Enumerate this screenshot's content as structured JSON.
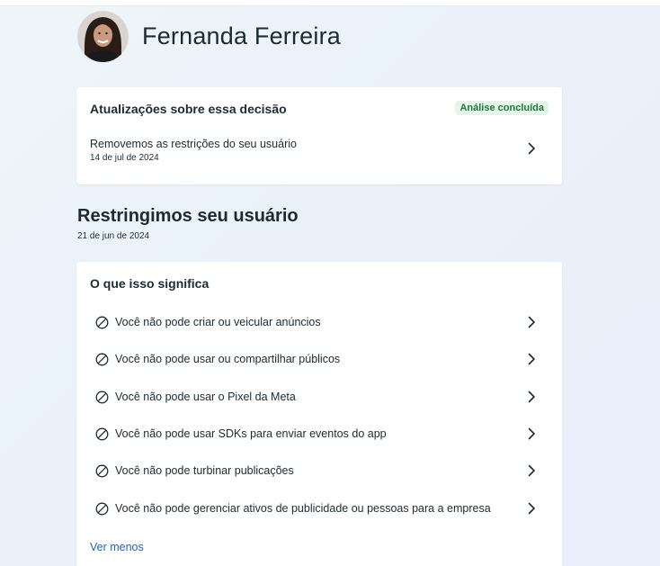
{
  "profile": {
    "name": "Fernanda Ferreira"
  },
  "updates_card": {
    "title": "Atualizações sobre essa decisão",
    "badge": "Análise concluída",
    "update_text": "Removemos as restrições do seu usuário",
    "update_date": "14 de jul de 2024"
  },
  "restriction": {
    "title": "Restringimos seu usuário",
    "date": "21 de jun de 2024"
  },
  "meaning_card": {
    "title": "O que isso significa",
    "items": [
      {
        "label": "Você não pode criar ou veicular anúncios",
        "icon": "ban-icon"
      },
      {
        "label": "Você não pode usar ou compartilhar públicos",
        "icon": "ban-icon"
      },
      {
        "label": "Você não pode usar o Pixel da Meta",
        "icon": "ban-icon"
      },
      {
        "label": "Você não pode usar SDKs para enviar eventos do app",
        "icon": "ban-icon"
      },
      {
        "label": "Você não pode turbinar publicações",
        "icon": "ban-icon"
      },
      {
        "label": "Você não pode gerenciar ativos de publicidade ou pessoas para a empresa",
        "icon": "ban-icon"
      }
    ],
    "see_less": "Ver menos"
  },
  "colors": {
    "text": "#1c2b33",
    "link": "#1a63c6",
    "badge_bg": "#e6f4ea",
    "badge_text": "#1d7a3a"
  }
}
